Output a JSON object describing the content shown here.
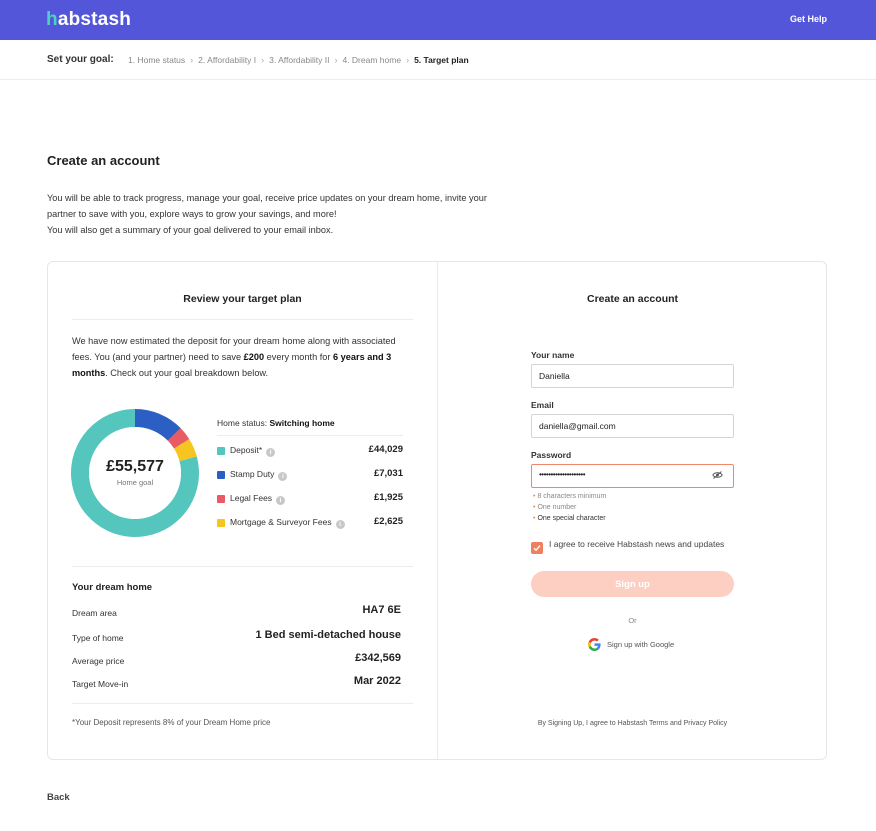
{
  "header": {
    "logo_first": "h",
    "logo_rest": "abstash",
    "help_link": "Get Help",
    "brand_color": "#5356d9",
    "accent_color": "#4ed1c0"
  },
  "steps": {
    "title": "Set your goal:",
    "items": [
      {
        "label": "1. Home status"
      },
      {
        "label": "2. Affordability I"
      },
      {
        "label": "3. Affordability II"
      },
      {
        "label": "4. Dream home"
      },
      {
        "label": "5. Target plan"
      }
    ]
  },
  "page": {
    "title": "Create an account",
    "intro_1": "You will be able to track progress, manage your goal, receive price updates on your dream home, invite your partner to save with you, explore ways to grow your savings, and more!",
    "intro_2": "You will also get a summary of your goal delivered to your email inbox.",
    "back": "Back"
  },
  "review": {
    "title": "Review your target plan",
    "summary_a": "We have now estimated the deposit for your dream home along with associated fees. You (and your partner) need to save ",
    "summary_amount": "£200",
    "summary_b": " every month for ",
    "summary_duration": "6 years and 3 months",
    "summary_c": ". Check out your goal breakdown below.",
    "total": "£55,577",
    "total_label": "Home goal",
    "home_status_label": "Home status: ",
    "home_status_value": "Switching home",
    "breakdown": [
      {
        "label": "Deposit*",
        "value": "£44,029",
        "amount": 44029,
        "color": "#55c6bd"
      },
      {
        "label": "Stamp Duty",
        "value": "£7,031",
        "amount": 7031,
        "color": "#2b5fc3"
      },
      {
        "label": "Legal Fees",
        "value": "£1,925",
        "amount": 1925,
        "color": "#e95b62"
      },
      {
        "label": "Mortgage & Surveyor Fees",
        "value": "£2,625",
        "amount": 2625,
        "color": "#f7c51f"
      }
    ],
    "info_glyph": "i",
    "dream_title": "Your dream home",
    "dream": [
      {
        "key": "Dream area",
        "value": "HA7 6E"
      },
      {
        "key": "Type of home",
        "value": "1 Bed semi-detached house"
      },
      {
        "key": "Average price",
        "value": "£342,569"
      },
      {
        "key": "Target Move-in",
        "value": "Mar 2022"
      }
    ],
    "footnote": "*Your Deposit represents 8% of your Dream Home price"
  },
  "signup": {
    "title": "Create an account",
    "name_label": "Your name",
    "name_value": "Daniella",
    "email_label": "Email",
    "email_value": "daniella@gmail.com",
    "password_label": "Password",
    "password_mask": "••••••••••••••••••••",
    "hints": [
      "8 characters minimum",
      "One number",
      "One special character"
    ],
    "hint_dot": "•",
    "consent": "I agree to receive Habstash news and updates",
    "button": "Sign up",
    "or": "Or",
    "google": "Sign up with Google",
    "terms": "By Signing Up, I agree to Habstash Terms and Privacy Policy"
  }
}
